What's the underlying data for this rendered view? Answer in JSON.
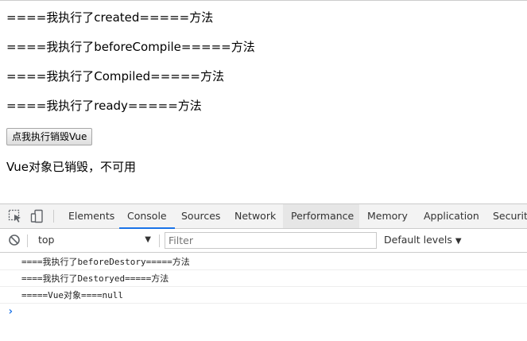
{
  "page": {
    "lines": [
      "====我执行了created=====方法",
      "====我执行了beforeCompile=====方法",
      "====我执行了Compiled=====方法",
      "====我执行了ready=====方法"
    ],
    "destroy_button_label": "点我执行销毁Vue",
    "status_text": "Vue对象已销毁，不可用"
  },
  "devtools": {
    "toolbar_icons": [
      "inspect-element-icon",
      "device-toolbar-icon"
    ],
    "tabs": [
      {
        "label": "Elements",
        "state": "normal"
      },
      {
        "label": "Console",
        "state": "selected"
      },
      {
        "label": "Sources",
        "state": "normal"
      },
      {
        "label": "Network",
        "state": "normal"
      },
      {
        "label": "Performance",
        "state": "hovered"
      },
      {
        "label": "Memory",
        "state": "normal"
      },
      {
        "label": "Application",
        "state": "normal"
      },
      {
        "label": "Security",
        "state": "normal"
      }
    ],
    "filterbar": {
      "clear_icon": "clear-console-icon",
      "context": "top",
      "filter_placeholder": "Filter",
      "levels_label": "Default levels"
    },
    "console_messages": [
      "====我执行了beforeDestory=====方法",
      "====我执行了Destoryed=====方法",
      "=====Vue对象====null"
    ],
    "prompt_symbol": "›"
  },
  "colors": {
    "accent": "#1a73e8",
    "tabbar_bg": "#f3f3f3",
    "hovered_tab_bg": "#e6e6e6"
  }
}
